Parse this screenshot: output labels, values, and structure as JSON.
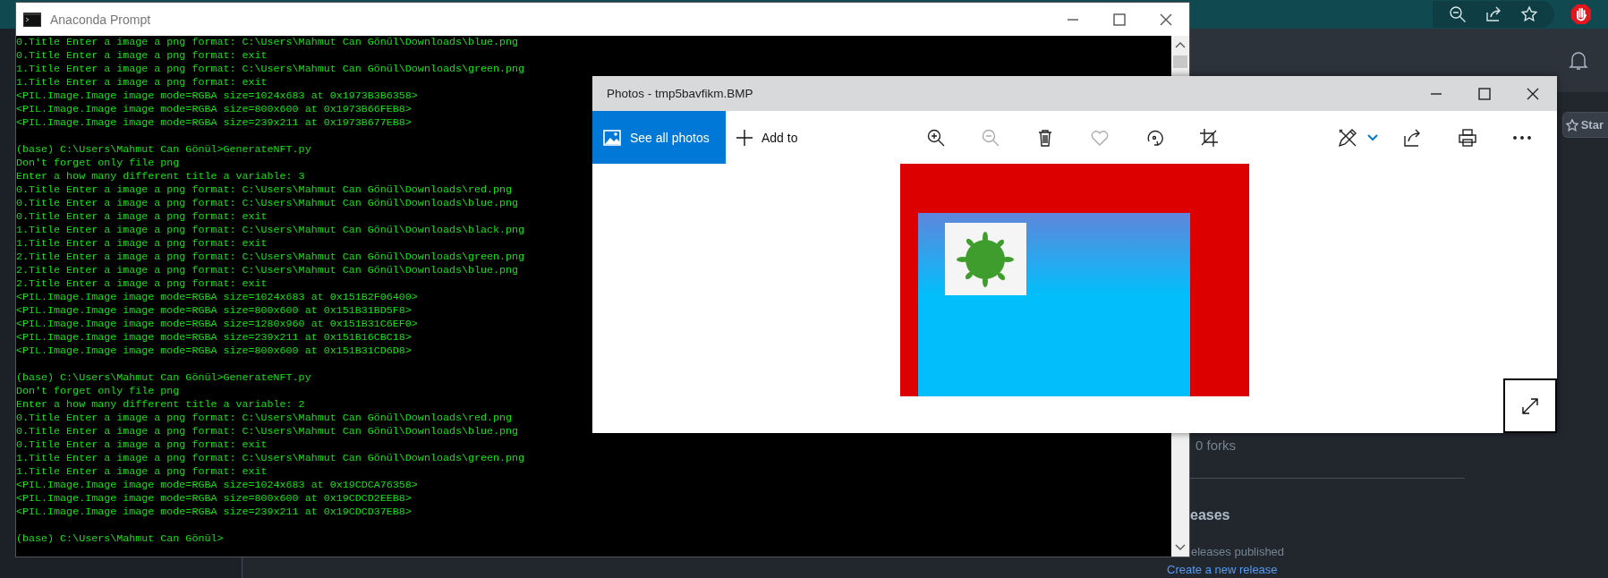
{
  "browser": {
    "star_button": "Star",
    "forks": "0 forks",
    "releases_heading": "eases",
    "releases_note": "eleases published",
    "create_release_link": "Create a new release"
  },
  "terminal": {
    "title": "Anaconda Prompt",
    "blocks": [
      [
        "0.Title Enter a image a png format: C:\\Users\\Mahmut Can Gönül\\Downloads\\blue.png",
        "0.Title Enter a image a png format: exit",
        "1.Title Enter a image a png format: C:\\Users\\Mahmut Can Gönül\\Downloads\\green.png",
        "1.Title Enter a image a png format: exit",
        "<PIL.Image.Image image mode=RGBA size=1024x683 at 0x1973B3B6358>",
        "<PIL.Image.Image image mode=RGBA size=800x600 at 0x1973B66FEB8>",
        "<PIL.Image.Image image mode=RGBA size=239x211 at 0x1973B677EB8>"
      ],
      [
        "(base) C:\\Users\\Mahmut Can Gönül>GenerateNFT.py",
        "Don't forget only file png",
        "Enter a how many different title a variable: 3",
        "0.Title Enter a image a png format: C:\\Users\\Mahmut Can Gönül\\Downloads\\red.png",
        "0.Title Enter a image a png format: C:\\Users\\Mahmut Can Gönül\\Downloads\\blue.png",
        "0.Title Enter a image a png format: exit",
        "1.Title Enter a image a png format: C:\\Users\\Mahmut Can Gönül\\Downloads\\black.png",
        "1.Title Enter a image a png format: exit",
        "2.Title Enter a image a png format: C:\\Users\\Mahmut Can Gönül\\Downloads\\green.png",
        "2.Title Enter a image a png format: C:\\Users\\Mahmut Can Gönül\\Downloads\\blue.png",
        "2.Title Enter a image a png format: exit",
        "<PIL.Image.Image image mode=RGBA size=1024x683 at 0x151B2F06400>",
        "<PIL.Image.Image image mode=RGBA size=800x600 at 0x151B31BD5F8>",
        "<PIL.Image.Image image mode=RGBA size=1280x960 at 0x151B31C6EF0>",
        "<PIL.Image.Image image mode=RGBA size=239x211 at 0x151B16CBC18>",
        "<PIL.Image.Image image mode=RGBA size=800x600 at 0x151B31CD6D8>"
      ],
      [
        "(base) C:\\Users\\Mahmut Can Gönül>GenerateNFT.py",
        "Don't forget only file png",
        "Enter a how many different title a variable: 2",
        "0.Title Enter a image a png format: C:\\Users\\Mahmut Can Gönül\\Downloads\\red.png",
        "0.Title Enter a image a png format: C:\\Users\\Mahmut Can Gönül\\Downloads\\blue.png",
        "0.Title Enter a image a png format: exit",
        "1.Title Enter a image a png format: C:\\Users\\Mahmut Can Gönül\\Downloads\\green.png",
        "1.Title Enter a image a png format: exit",
        "<PIL.Image.Image image mode=RGBA size=1024x683 at 0x19CDCA76358>",
        "<PIL.Image.Image image mode=RGBA size=800x600 at 0x19CDCD2EEB8>",
        "<PIL.Image.Image image mode=RGBA size=239x211 at 0x19CDCD37EB8>"
      ],
      [
        "(base) C:\\Users\\Mahmut Can Gönül>"
      ]
    ]
  },
  "photos": {
    "title": "Photos - tmp5bavfikm.BMP",
    "see_all": "See all photos",
    "add_to": "Add to",
    "tools": [
      {
        "kind": "zoom-in",
        "disabled": false
      },
      {
        "kind": "zoom-out",
        "disabled": true
      },
      {
        "kind": "delete",
        "disabled": false
      },
      {
        "kind": "favorite",
        "disabled": true
      },
      {
        "kind": "rotate",
        "disabled": false
      },
      {
        "kind": "crop",
        "disabled": false
      }
    ]
  }
}
